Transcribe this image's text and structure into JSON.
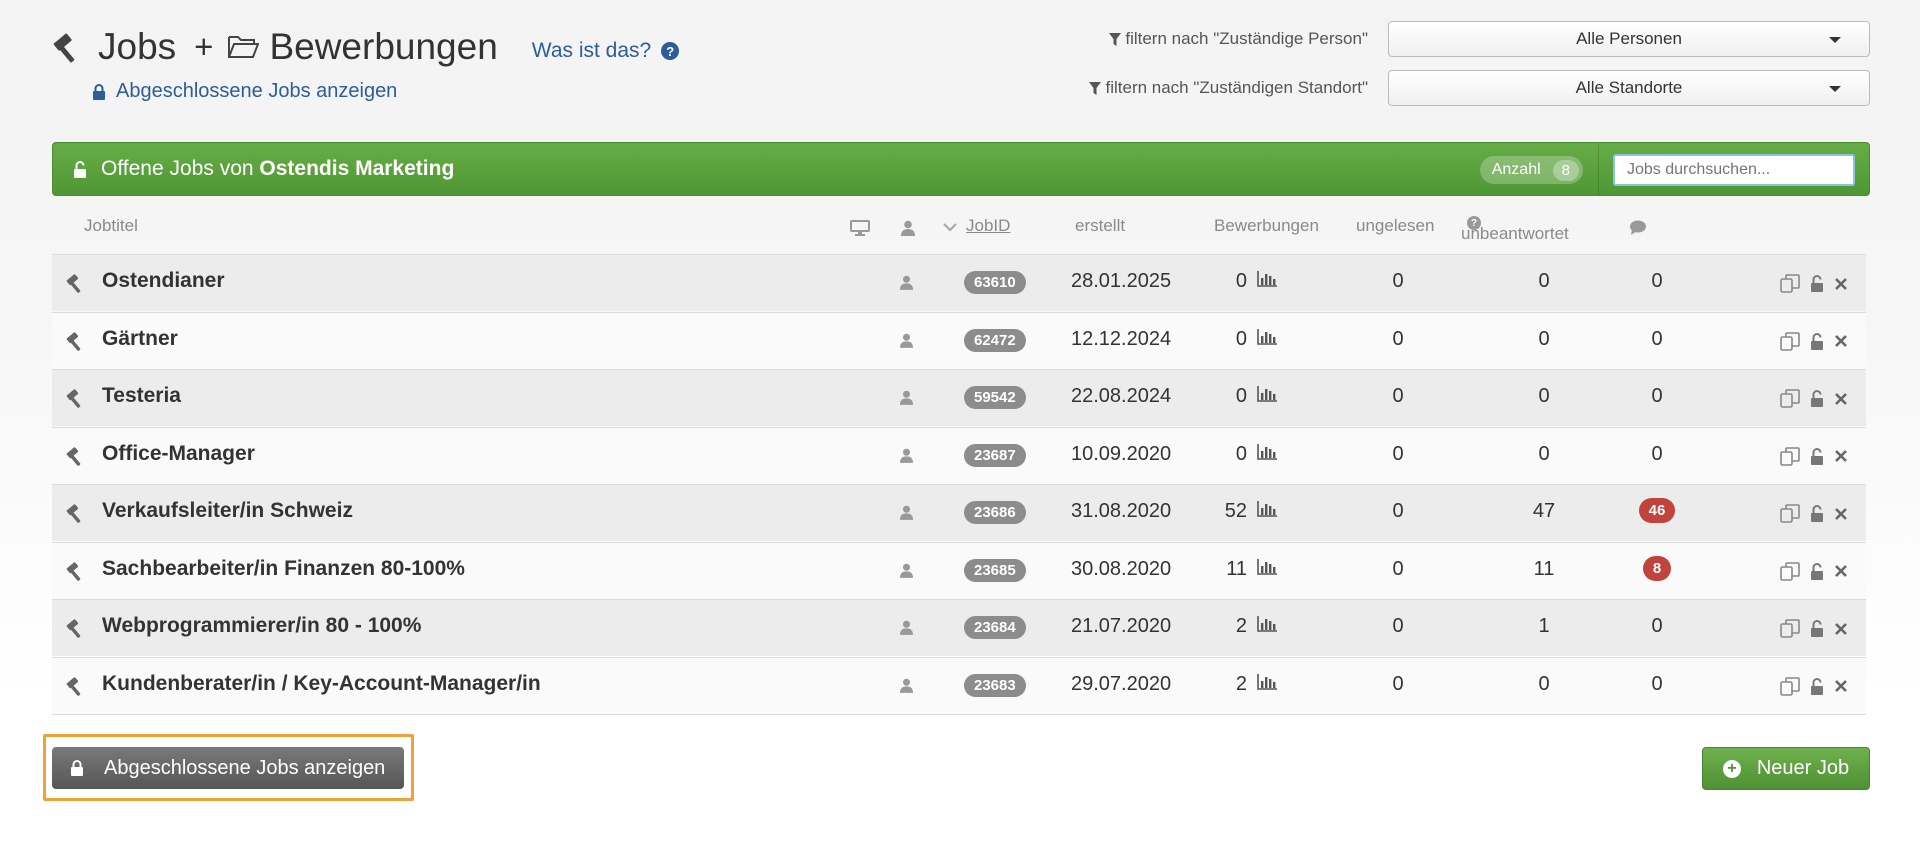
{
  "header": {
    "title_jobs": "Jobs",
    "plus": "+",
    "title_bewerbungen": "Bewerbungen",
    "what_is_this": "Was ist das?",
    "show_closed_link": "Abgeschlossene Jobs anzeigen"
  },
  "filters": {
    "person_label": "filtern nach \"Zuständige Person\"",
    "person_value": "Alle Personen",
    "location_label": "filtern nach \"Zuständigen Standort\"",
    "location_value": "Alle Standorte"
  },
  "panel": {
    "title_prefix": "Offene Jobs von ",
    "company": "Ostendis Marketing",
    "count_label": "Anzahl",
    "count": "8",
    "search_placeholder": "Jobs durchsuchen..."
  },
  "table": {
    "headers": {
      "jobtitle": "Jobtitel",
      "jobid": "JobID",
      "created": "erstellt",
      "applications": "Bewerbungen",
      "unread": "ungelesen",
      "unanswered": "unbeantwortet"
    },
    "rows": [
      {
        "title": "Ostendianer",
        "id": "63610",
        "date": "28.01.2025",
        "apps": "0",
        "unread": "0",
        "unanswered": "0",
        "comments": "0",
        "comments_alert": false
      },
      {
        "title": "Gärtner",
        "id": "62472",
        "date": "12.12.2024",
        "apps": "0",
        "unread": "0",
        "unanswered": "0",
        "comments": "0",
        "comments_alert": false
      },
      {
        "title": "Testeria",
        "id": "59542",
        "date": "22.08.2024",
        "apps": "0",
        "unread": "0",
        "unanswered": "0",
        "comments": "0",
        "comments_alert": false
      },
      {
        "title": "Office-Manager",
        "id": "23687",
        "date": "10.09.2020",
        "apps": "0",
        "unread": "0",
        "unanswered": "0",
        "comments": "0",
        "comments_alert": false
      },
      {
        "title": "Verkaufsleiter/in Schweiz",
        "id": "23686",
        "date": "31.08.2020",
        "apps": "52",
        "unread": "0",
        "unanswered": "47",
        "comments": "46",
        "comments_alert": true
      },
      {
        "title": "Sachbearbeiter/in Finanzen 80-100%",
        "id": "23685",
        "date": "30.08.2020",
        "apps": "11",
        "unread": "0",
        "unanswered": "11",
        "comments": "8",
        "comments_alert": true
      },
      {
        "title": "Webprogrammierer/in 80 - 100%",
        "id": "23684",
        "date": "21.07.2020",
        "apps": "2",
        "unread": "0",
        "unanswered": "1",
        "comments": "0",
        "comments_alert": false
      },
      {
        "title": "Kundenberater/in / Key-Account-Manager/in",
        "id": "23683",
        "date": "29.07.2020",
        "apps": "2",
        "unread": "0",
        "unanswered": "0",
        "comments": "0",
        "comments_alert": false
      }
    ]
  },
  "footer": {
    "show_closed_button": "Abgeschlossene Jobs anzeigen",
    "new_job_button": "Neuer Job"
  },
  "colors": {
    "green": "#5aa03d",
    "link_blue": "#2d5d99",
    "alert_red": "#c0433c",
    "highlight_orange": "#efa13f"
  },
  "icons": [
    "hammer-icon",
    "folder-open-icon",
    "question-circle-icon",
    "lock-icon",
    "unlock-icon",
    "funnel-icon",
    "desktop-icon",
    "user-icon",
    "chevron-down-icon",
    "bar-chart-icon",
    "comment-icon",
    "copy-icon",
    "close-icon",
    "plus-circle-icon"
  ]
}
